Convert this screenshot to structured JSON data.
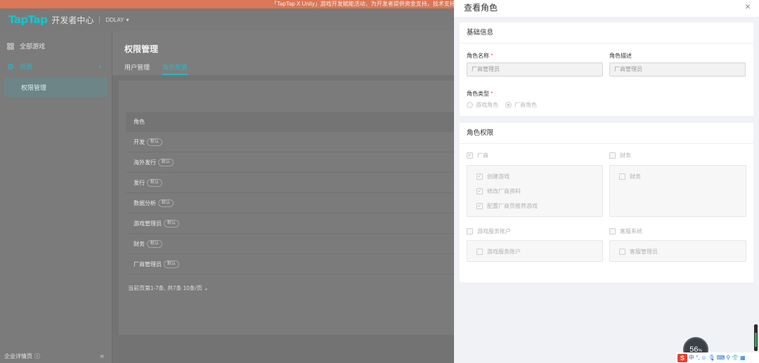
{
  "banner": {
    "text": "「TapTap X Unity」游戏开发赋能活动，为开发者提供资金支持，技术支持..."
  },
  "header": {
    "logo": "TapTap",
    "logo_sub": "开发者中心",
    "org": "DDLAY",
    "org_caret": "▾"
  },
  "sidebar": {
    "items": [
      {
        "label": "全部游戏",
        "icon": "grid-icon"
      },
      {
        "label": "设置",
        "icon": "settings-icon",
        "caret": "▲"
      }
    ],
    "sub_item": "权限管理",
    "footer": "企业详情页",
    "footer_icon": "ⓘ",
    "collapse": "«"
  },
  "main": {
    "title": "权限管理",
    "tabs": [
      "用户管理",
      "角色配置"
    ],
    "table_header": "角色",
    "rows": [
      {
        "name": "开发",
        "tag": "默认"
      },
      {
        "name": "海外发行",
        "tag": "默认"
      },
      {
        "name": "发行",
        "tag": "默认"
      },
      {
        "name": "数据分析",
        "tag": "默认"
      },
      {
        "name": "游戏管理员",
        "tag": "默认"
      },
      {
        "name": "财务",
        "tag": "默认"
      },
      {
        "name": "厂商管理员",
        "tag": "默认"
      }
    ],
    "pagination": "当前页第1-7条, 共7条  10条/页  ⌄"
  },
  "drawer": {
    "title": "查看角色",
    "close": "×",
    "basic": {
      "title": "基础信息",
      "name_label": "角色名称",
      "name_value": "厂商管理员",
      "desc_label": "角色描述",
      "desc_value": "厂商管理员",
      "type_label": "角色类型",
      "required_mark": "*",
      "type_options": [
        {
          "label": "游戏角色",
          "selected": false
        },
        {
          "label": "厂商角色",
          "selected": true
        }
      ]
    },
    "perms": {
      "title": "角色权限",
      "groups": [
        {
          "label": "厂商",
          "checked": true,
          "children": [
            {
              "label": "创建游戏",
              "checked": true
            },
            {
              "label": "修改厂商资料",
              "checked": true
            },
            {
              "label": "配置厂商页推荐游戏",
              "checked": true
            }
          ]
        },
        {
          "label": "财务",
          "checked": false,
          "children": [
            {
              "label": "财务",
              "checked": false
            }
          ]
        },
        {
          "label": "游戏服务账户",
          "checked": false,
          "children": [
            {
              "label": "游戏服务账户",
              "checked": false
            }
          ]
        },
        {
          "label": "客服系统",
          "checked": false,
          "children": [
            {
              "label": "客服管理员",
              "checked": false
            }
          ]
        }
      ]
    }
  },
  "system": {
    "gauge_value": "56",
    "gauge_unit": "%",
    "ime": "中"
  }
}
